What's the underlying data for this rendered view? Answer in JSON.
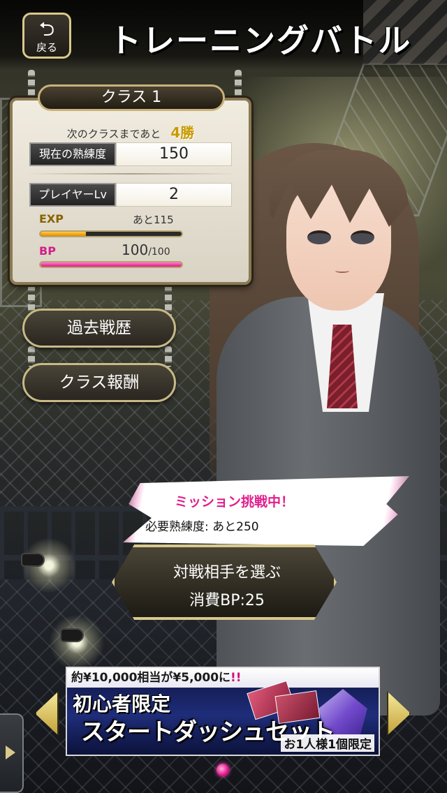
{
  "header": {
    "back_label": "戻る",
    "title": "トレーニングバトル"
  },
  "class_panel": {
    "class_name": "クラス 1",
    "next_class_text": "次のクラスまであと",
    "wins_remaining": "4勝",
    "proficiency_label": "現在の熟練度",
    "proficiency_value": "150",
    "player_lv_label": "プレイヤーLv",
    "player_lv_value": "2",
    "exp_label": "EXP",
    "exp_remaining": "あと115",
    "exp_progress": 0.32,
    "bp_label": "BP",
    "bp_current": "100",
    "bp_max": "/100",
    "bp_progress": 1.0
  },
  "side_buttons": {
    "history": "過去戦歴",
    "rewards": "クラス報酬"
  },
  "mission": {
    "title": "ミッション挑戦中！",
    "requirement": "必要熟練度: あと250"
  },
  "select_opponent": {
    "line1": "対戦相手を選ぶ",
    "line2": "消費BP:25"
  },
  "promo": {
    "top_prefix": "約¥10,000相当が¥5,000に",
    "top_suffix": "!!",
    "line1": "初心者限定",
    "line2": "スタートダッシュセット",
    "note": "お1人様1個限定"
  },
  "colors": {
    "accent_gold": "#d8c88c",
    "bp_pink": "#e0148a",
    "exp_orange": "#e58a00"
  },
  "icons": {
    "back": "return-arrow-icon",
    "carousel_left": "triangle-left-icon",
    "carousel_right": "triangle-right-icon"
  }
}
